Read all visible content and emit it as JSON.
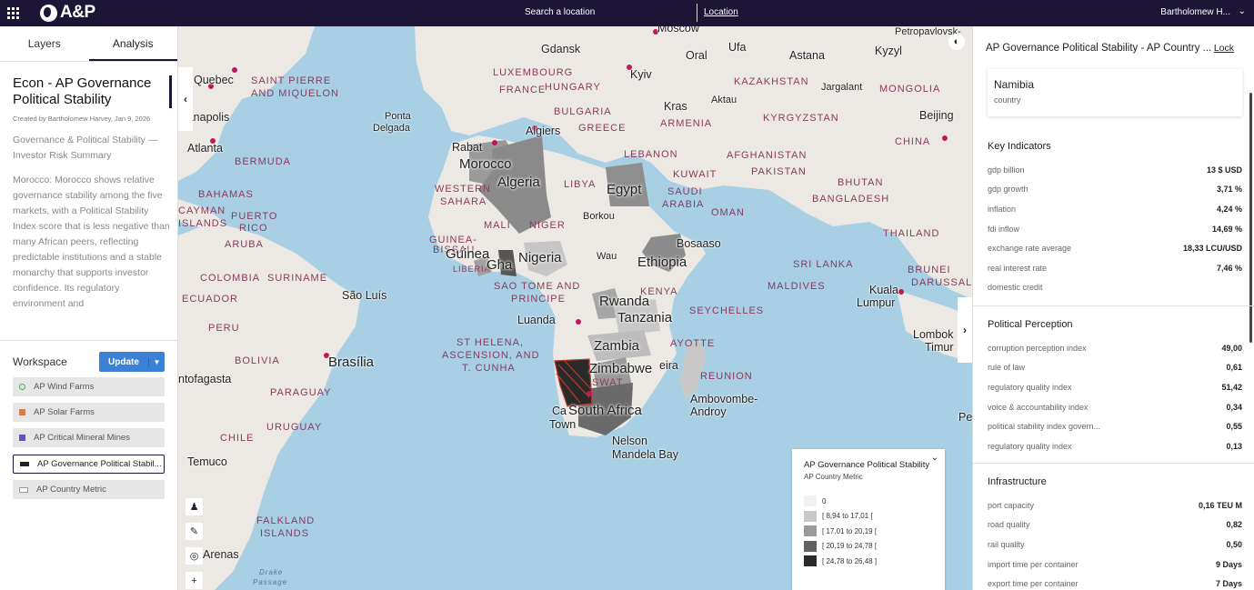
{
  "topbar": {
    "brand": "A&P",
    "search_placeholder": "Search a location",
    "location_link": "Location",
    "user_name": "Bartholomew H...",
    "user_caret": "⌄"
  },
  "left_panel": {
    "tabs": [
      "Layers",
      "Analysis"
    ],
    "active_tab": "Analysis",
    "analysis": {
      "title": "Econ - AP Governance Political Stability",
      "created": "Created by Bartholomew Harvey, Jan 9, 2026",
      "subtitle": "Governance & Political Stability — Investor Risk Summary",
      "body": "Morocco: Morocco shows relative governance stability among the five markets, with a Political Stability Index score that is less negative than many African peers, reflecting predictable institutions and a stable monarchy that supports investor confidence. Its regulatory environment and"
    },
    "workspace": {
      "label": "Workspace",
      "update_button": "Update",
      "layers": [
        {
          "label": "AP Wind Farms",
          "color": "#4caf50",
          "shape": "ring"
        },
        {
          "label": "AP Solar Farms",
          "color": "#e07b39",
          "shape": "square"
        },
        {
          "label": "AP Critical Mineral Mines",
          "color": "#6b4fbb",
          "shape": "square"
        },
        {
          "label": "AP Governance Political Stabil...",
          "color": "#222222",
          "shape": "wide"
        },
        {
          "label": "AP Country Metric",
          "color": "#ffffff",
          "shape": "wide-outline"
        }
      ],
      "selected_layer": 3
    }
  },
  "map": {
    "labels": {
      "moscow": "Moscow",
      "gdansk": "Gdansk",
      "ufa": "Ufa",
      "oral": "Oral",
      "astana": "Astana",
      "kyzyl": "Kyzyl",
      "petropavlovsk": "Petropavlovsk-",
      "quebec": "Quebec",
      "saint_pierre": "SAINT PIERRE",
      "and_miquelon": "AND MIQUELON",
      "luxembourg": "LUXEMBOURG",
      "kyiv": "Kyiv",
      "kazakhstan": "KAZAKHSTAN",
      "jargalant": "Jargalant",
      "mongolia": "MONGOLIA",
      "france": "FRANCE",
      "hungary": "HUNGARY",
      "aktau": "Aktau",
      "indianapolis": "dianapolis",
      "ponta": "Ponta",
      "delgada": "Delgada",
      "bulgaria": "BULGARIA",
      "kras": "Kras",
      "armenia": "ARMENIA",
      "kyrgyzstan": "KYRGYZSTAN",
      "beijing": "Beijing",
      "algiers": "Algiers",
      "greece": "GREECE",
      "china": "CHINA",
      "atlanta": "Atlanta",
      "rabat": "Rabat",
      "lebanon": "LEBANON",
      "afghanistan": "AFGHANISTAN",
      "bermuda": "BERMUDA",
      "morocco": "Morocco",
      "kuwait": "KUWAIT",
      "pakistan": "PAKISTAN",
      "bahamas": "BAHAMAS",
      "algeria": "Algeria",
      "libya": "LIBYA",
      "egypt": "Egypt",
      "bhutan": "BHUTAN",
      "western": "WESTERN",
      "sahara": "SAHARA",
      "saudi": "SAUDI",
      "arabia": "ARABIA",
      "bangladesh": "BANGLADESH",
      "cayman": "CAYMAN",
      "islands": "ISLANDS",
      "puerto": "PUERTO",
      "rico": "RICO",
      "borkou": "Borkou",
      "oman": "OMAN",
      "mali": "MALI",
      "niger": "NIGER",
      "aruba": "ARUBA",
      "guinea_bissau": "GUINEA-",
      "bissau": "BISSAU",
      "bosaaso": "Bosaaso",
      "thailand": "THAILAND",
      "guinea": "Guinea",
      "nigeria": "Nigeria",
      "wau": "Wau",
      "liberia": "LIBERIA",
      "ghana": "Gha",
      "ethiopia": "Ethiopia",
      "sri_lanka": "SRI LANKA",
      "colombia": "COLOMBIA",
      "suriname": "SURINAME",
      "brunei": "BRUNEI",
      "darussalam": "DARUSSAL",
      "sao_tome": "SAO TOME AND",
      "principe": "PRINCIPE",
      "kenya": "KENYA",
      "maldives": "MALDIVES",
      "kuala": "Kuala",
      "lumpur": "Lumpur",
      "ecuador": "ECUADOR",
      "sao_luis": "São Luís",
      "rwanda": "Rwanda",
      "tanzania": "Tanzania",
      "luanda": "Luanda",
      "seychelles": "SEYCHELLES",
      "peru": "PERU",
      "st_helena": "ST HELENA,",
      "ascension": "ASCENSION, AND",
      "tristan": "T. CUNHA",
      "zambia": "Zambia",
      "mayotte": "AYOTTE",
      "lombok": "Lombok",
      "timur": "Timur",
      "brasilia": "Brasília",
      "bolivia": "BOLIVIA",
      "zimbabwe": "Zimbabwe",
      "madagascar": "eira",
      "antofagasta": "ntofagasta",
      "reunion": "REUNION",
      "eswatini": "SWAT",
      "paraguay": "PARAGUAY",
      "ambovombe": "Ambovombe-",
      "androy": "Androy",
      "cape_town_1": "Ca",
      "cape_town_2": "Town",
      "south_africa": "South Africa",
      "uruguay": "URUGUAY",
      "chile": "CHILE",
      "nelson": "Nelson",
      "mandela": "Mandela Bay",
      "temuco": "Temuco",
      "falkland": "FALKLAND",
      "falkland2": "ISLANDS",
      "arenas": "Arenas",
      "drake": "Drake",
      "passage": "Passage",
      "pe": "Pe"
    },
    "legend": {
      "title": "AP Governance Political Stability",
      "subtitle": "AP Country Metric",
      "rows": [
        {
          "label": "0",
          "color": "#f2f2f2"
        },
        {
          "label": "[ 8,94 to 17,01 [",
          "color": "#c8c8c8"
        },
        {
          "label": "[ 17,01 to 20,19 [",
          "color": "#9a9a9a"
        },
        {
          "label": "[ 20,19 to 24,78 [",
          "color": "#626262"
        },
        {
          "label": "[ 24,78 to 26,48 ]",
          "color": "#2a2a2a"
        }
      ]
    }
  },
  "right_panel": {
    "header": "AP Governance Political Stability - AP Country ...",
    "lock": "Lock",
    "country": {
      "name": "Namibia",
      "type": "country"
    },
    "sections": [
      {
        "title": "Key Indicators",
        "rows": [
          {
            "k": "gdp billion",
            "v": "13 $ USD"
          },
          {
            "k": "gdp growth",
            "v": "3,71 %"
          },
          {
            "k": "inflation",
            "v": "4,24 %"
          },
          {
            "k": "fdi inflow",
            "v": "14,69 %"
          },
          {
            "k": "exchange rate average",
            "v": "18,33 LCU/USD"
          },
          {
            "k": "real interest rate",
            "v": "7,46 %"
          },
          {
            "k": "domestic credit",
            "v": ""
          }
        ]
      },
      {
        "title": "Political Perception",
        "rows": [
          {
            "k": "corruption perception index",
            "v": "49,00"
          },
          {
            "k": "rule of law",
            "v": "0,61"
          },
          {
            "k": "regulatory quality index",
            "v": "51,42"
          },
          {
            "k": "voice & accountability index",
            "v": "0,34"
          },
          {
            "k": "political stability index govern...",
            "v": "0,55"
          },
          {
            "k": "regulatory quality index",
            "v": "0,13"
          }
        ]
      },
      {
        "title": "Infrastructure",
        "rows": [
          {
            "k": "port capacity",
            "v": "0,16 TEU M"
          },
          {
            "k": "road quality",
            "v": "0,82"
          },
          {
            "k": "rail quality",
            "v": "0,50"
          },
          {
            "k": "import time per container",
            "v": "9 Days"
          },
          {
            "k": "export time per container",
            "v": "7 Days"
          }
        ]
      }
    ]
  }
}
